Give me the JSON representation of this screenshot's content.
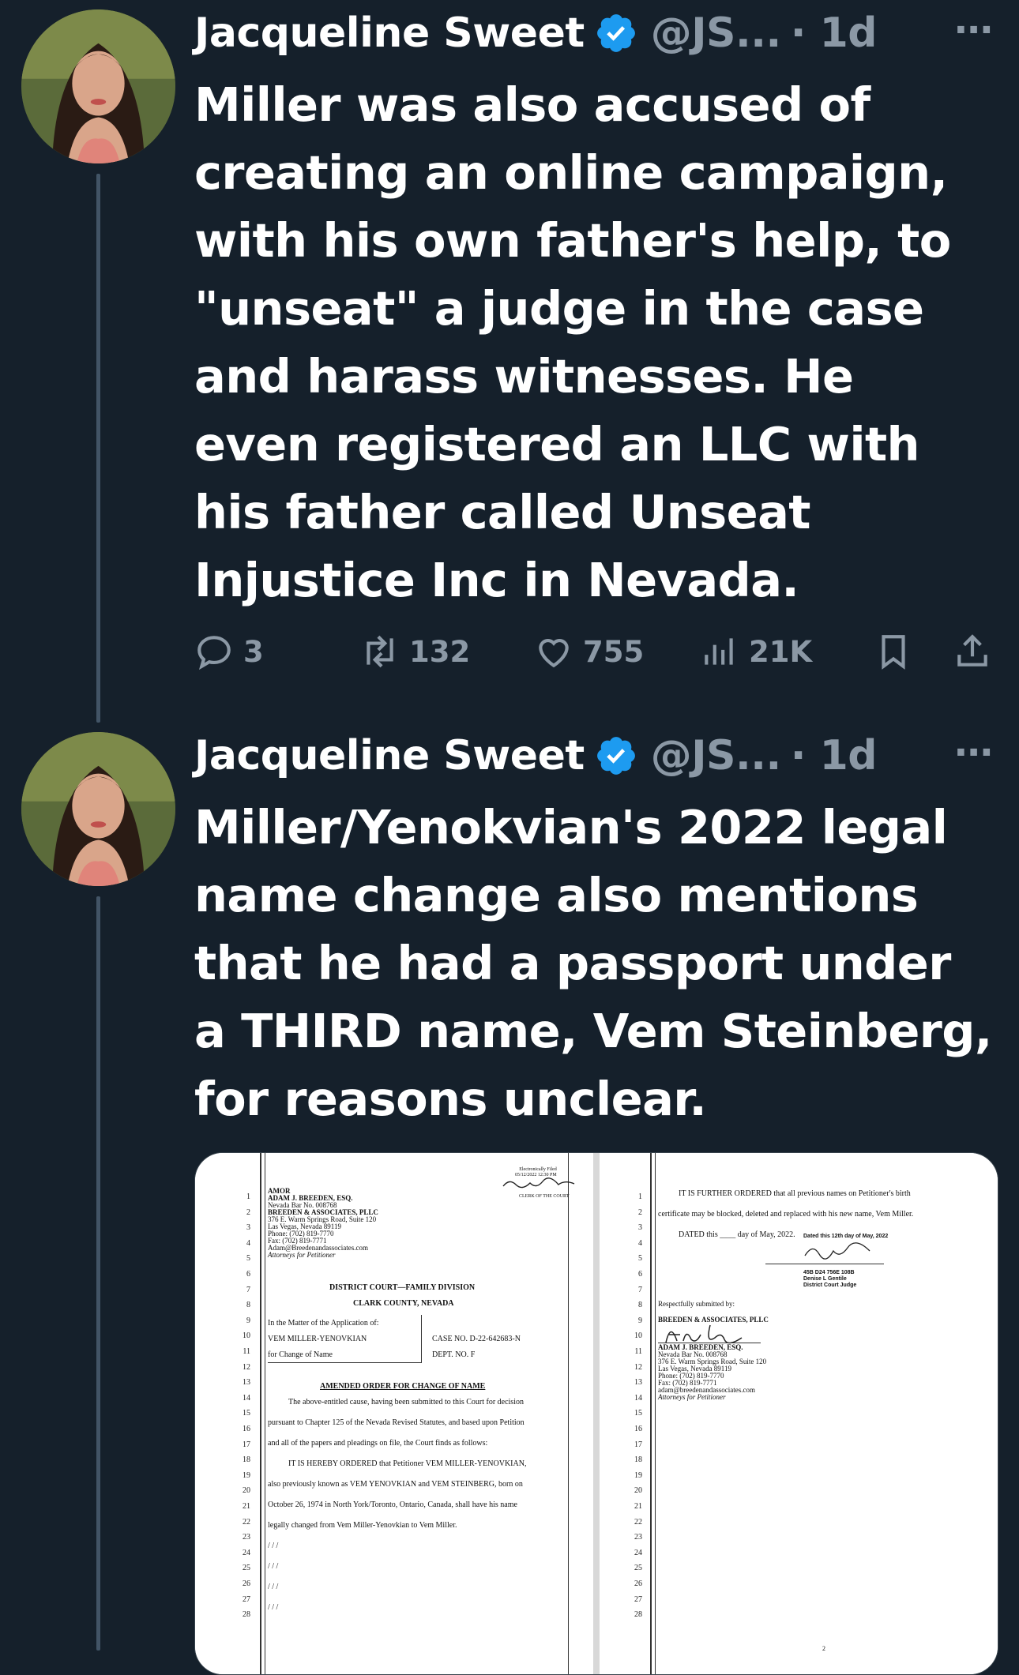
{
  "tweets": [
    {
      "display_name": "Jacqueline Sweet",
      "handle": "@JS...",
      "time": "· 1d",
      "more": "···",
      "text": "Miller was also accused of creating an online campaign, with his own father's help, to \"unseat\" a judge in the case and harass witnesses. He even registered an LLC with his father called Unseat Injustice Inc in Nevada.",
      "replies": "3",
      "retweets": "132",
      "likes": "755",
      "views": "21K"
    },
    {
      "display_name": "Jacqueline Sweet",
      "handle": "@JS...",
      "time": "· 1d",
      "more": "···",
      "text": "Miller/Yenokvian's 2022 legal name change also mentions that he had a passport under a THIRD name, Vem Steinberg, for reasons unclear."
    }
  ],
  "document": {
    "page1": {
      "filing_stamp": [
        "Electronically Filed",
        "05/12/2022 12:30 PM"
      ],
      "clerk": "CLERK OF THE COURT",
      "header_lines": [
        "AMOR",
        "ADAM J. BREEDEN, ESQ.",
        "Nevada Bar No. 008768",
        "BREEDEN & ASSOCIATES, PLLC",
        "376 E. Warm Springs Road, Suite 120",
        "Las Vegas, Nevada 89119",
        "Phone: (702) 819-7770",
        "Fax: (702) 819-7771",
        "Adam@Breedenandassociates.com",
        "Attorneys for Petitioner"
      ],
      "court": "DISTRICT COURT—FAMILY DIVISION",
      "county": "CLARK COUNTY, NEVADA",
      "caption_left": [
        "In the Matter of the Application of:",
        "VEM MILLER-YENOVKIAN",
        "for Change of Name"
      ],
      "case_no": "CASE NO. D-22-642683-N",
      "dept_no": "DEPT. NO. F",
      "order_title": "AMENDED ORDER FOR CHANGE OF NAME",
      "body_lines": [
        "The above-entitled cause, having been submitted to this Court for decision",
        "pursuant to Chapter 125 of the Nevada Revised Statutes, and based upon Petition",
        "and all of the papers and pleadings on file, the Court finds as follows:",
        "IT IS HEREBY ORDERED that Petitioner VEM MILLER-YENOVKIAN,",
        "also previously known as VEM YENOVKIAN and VEM STEINBERG, born on",
        "October 26, 1974 in North York/Toronto, Ontario, Canada, shall have his name",
        "legally changed from Vem Miller-Yenovkian to Vem Miller."
      ],
      "slashes": "/ / /"
    },
    "page2": {
      "line1": "IT IS FURTHER ORDERED that all previous names on Petitioner's birth",
      "line2": "certificate may be blocked, deleted and replaced with his new name, Vem Miller.",
      "dated": "DATED this ____ day of May, 2022.",
      "dated_stamp": "Dated this 12th day of May, 2022",
      "judge_lines": [
        "45B D24 756E 108B",
        "Denise L Gentile",
        "District Court Judge"
      ],
      "submitted": "Respectfully submitted by:",
      "firm": "BREEDEN & ASSOCIATES, PLLC",
      "sig_lines": [
        "ADAM J. BREEDEN, ESQ.",
        "Nevada Bar No. 008768",
        "376 E. Warm Springs Road, Suite 120",
        "Las Vegas, Nevada 89119",
        "Phone: (702) 819-7770",
        "Fax: (702) 819-7771",
        "adam@breedenandassociates.com",
        "Attorneys for Petitioner"
      ],
      "page_num": "2"
    }
  },
  "icons": {
    "reply": "reply-bubble-icon",
    "retweet": "retweet-icon",
    "like": "heart-icon",
    "views": "views-bar-icon",
    "bookmark": "bookmark-icon",
    "share": "share-icon",
    "verified": "verified-badge-icon"
  },
  "colors": {
    "background": "#15202b",
    "verified": "#1d9bf0",
    "muted": "#8b98a5"
  }
}
